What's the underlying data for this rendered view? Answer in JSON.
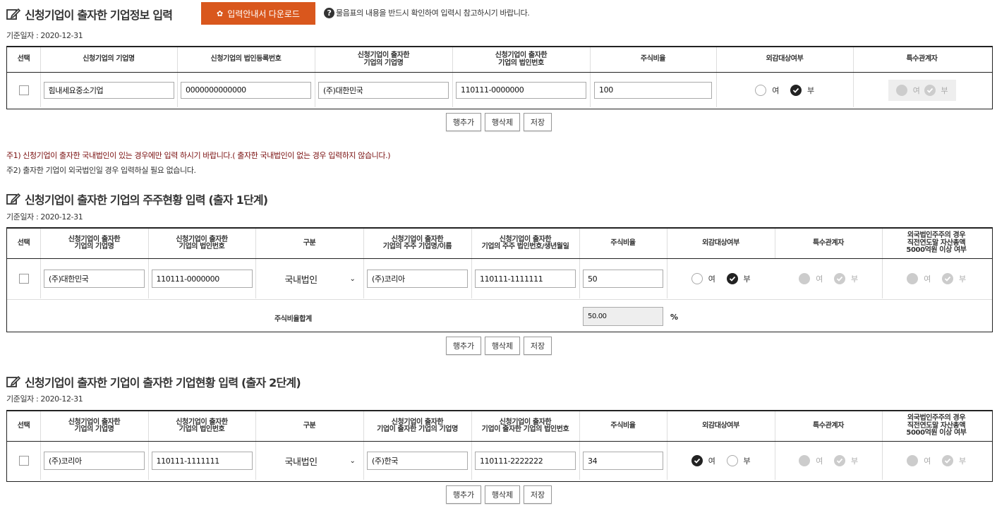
{
  "section1": {
    "title": "신청기업이 출자한 기업정보 입력",
    "download_label": "입력안내서 다운로드",
    "notice": "물음표의 내용을 반드시 확인하여 입력시 참고하시기 바랍니다.",
    "date": "기준일자 : 2020-12-31",
    "headers": [
      "선택",
      "신청기업의 기업명",
      "신청기업의 법인등록번호",
      "신청기업이 출자한\n기업의 기업명",
      "신청기업이 출자한\n기업의 법인번호",
      "주식비율",
      "외감대상여부",
      "특수관계자"
    ],
    "row": {
      "company_name": "힘내세요중소기업",
      "reg_no": "0000000000000",
      "invested_name": "(주)대한민국",
      "invested_no": "110111-0000000",
      "ratio": "100",
      "audit_yes": "여",
      "audit_no": "부",
      "special_yes": "여",
      "special_no": "부"
    },
    "buttons": [
      "행추가",
      "행삭제",
      "저장"
    ]
  },
  "notes": {
    "note1": "주1) 신청기업이 출자한 국내법인이 있는 경우에만 입력 하시기 바랍니다.( 출자한 국내법인이 없는 경우 입력하지 않습니다.)",
    "note2": "주2) 출자한 기업이 외국법인일 경우 입력하실 필요 없습니다."
  },
  "section2": {
    "title": "신청기업이 출자한 기업의 주주현황 입력 (출자 1단계)",
    "date": "기준일자 : 2020-12-31",
    "headers": [
      "선택",
      "신청기업이 출자한\n기업의 기업명",
      "신청기업이 출자한\n기업의 법인번호",
      "구분",
      "신청기업이 출자한\n기업의 주주 기업명/이름",
      "신청기업이 출자한\n기업의 주주 법인번호/생년월일",
      "주식비율",
      "외감대상여부",
      "특수관계자",
      "외국법인주주의 경우\n직전연도말 자산총액\n5000억원 이상 여부"
    ],
    "row": {
      "invested_name": "(주)대한민국",
      "invested_no": "110111-0000000",
      "type": "국내법인",
      "holder_name": "(주)코리아",
      "holder_no": "110111-1111111",
      "ratio": "50",
      "yes": "여",
      "no": "부"
    },
    "sum_label": "주식비율합계",
    "sum_value": "50.00",
    "sum_unit": "%",
    "buttons": [
      "행추가",
      "행삭제",
      "저장"
    ]
  },
  "section3": {
    "title": "신청기업이 출자한 기업이 출자한 기업현황 입력 (출자 2단계)",
    "date": "기준일자 : 2020-12-31",
    "headers": [
      "선택",
      "신청기업이 출자한\n기업의 기업명",
      "신청기업이 출자한\n기업의 법인번호",
      "구분",
      "신청기업이 출자한\n기업이 출자한 기업의 기업명",
      "신청기업이 출자한\n기업이 출자한 기업의 법인번호",
      "주식비율",
      "외감대상여부",
      "특수관계자",
      "외국법인주주의 경우\n직전연도말 자산총액\n5000억원 이상 여부"
    ],
    "row": {
      "invested_name": "(주)코리아",
      "invested_no": "110111-1111111",
      "type": "국내법인",
      "sub_name": "(주)한국",
      "sub_no": "110111-2222222",
      "ratio": "34",
      "yes": "여",
      "no": "부"
    },
    "buttons": [
      "행추가",
      "행삭제",
      "저장"
    ]
  }
}
